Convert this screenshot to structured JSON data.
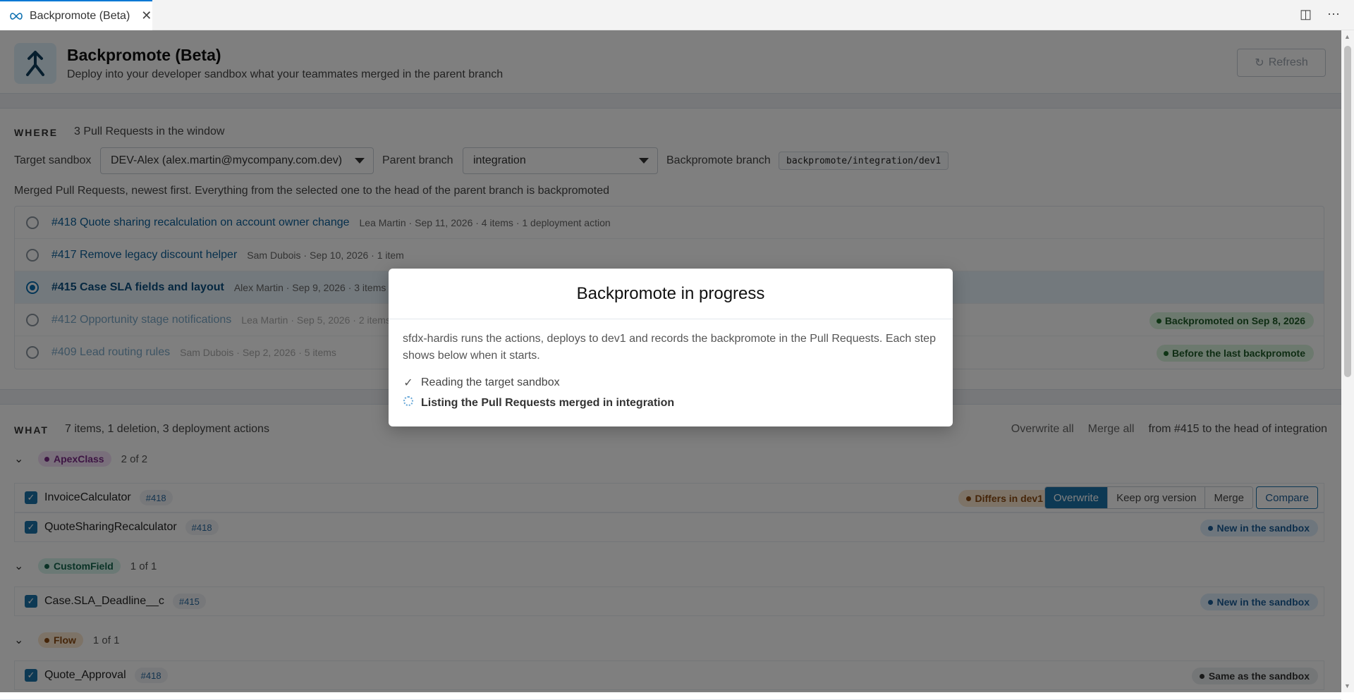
{
  "tab": {
    "title": "Backpromote (Beta)"
  },
  "header": {
    "title": "Backpromote (Beta)",
    "subtitle": "Deploy into your developer sandbox what your teammates merged in the parent branch",
    "refresh_label": "Refresh"
  },
  "where": {
    "label": "WHERE",
    "meta": "3 Pull Requests in the window",
    "target_label": "Target sandbox",
    "target_value": "DEV-Alex (alex.martin@mycompany.com.dev)",
    "parent_label": "Parent branch",
    "parent_value": "integration",
    "branch_label": "Backpromote branch",
    "branch_value": "backpromote/integration/dev1",
    "help": "Merged Pull Requests, newest first. Everything from the selected one to the head of the parent branch is backpromoted",
    "prs": [
      {
        "title": "#418 Quote sharing recalculation on account owner change",
        "meta": "Lea Martin · Sep 11, 2026 · 4 items · 1 deployment action",
        "badge": ""
      },
      {
        "title": "#417 Remove legacy discount helper",
        "meta": "Sam Dubois · Sep 10, 2026 · 1 item",
        "badge": ""
      },
      {
        "title": "#415 Case SLA fields and layout",
        "meta": "Alex Martin · Sep 9, 2026 · 3 items",
        "badge": ""
      },
      {
        "title": "#412 Opportunity stage notifications",
        "meta": "Lea Martin · Sep 5, 2026 · 2 items",
        "badge": "Backpromoted on Sep 8, 2026"
      },
      {
        "title": "#409 Lead routing rules",
        "meta": "Sam Dubois · Sep 2, 2026 · 5 items",
        "badge": "Before the last backpromote"
      }
    ]
  },
  "what": {
    "label": "WHAT",
    "meta": "7 items, 1 deletion, 3 deployment actions",
    "overwrite_all": "Overwrite all",
    "merge_all": "Merge all",
    "scope": "from #415 to the head of integration",
    "groups": [
      {
        "type": "ApexClass",
        "count": "2 of 2"
      },
      {
        "type": "CustomField",
        "count": "1 of 1"
      },
      {
        "type": "Flow",
        "count": "1 of 1"
      }
    ],
    "items": [
      {
        "name": "InvoiceCalculator",
        "pr": "#418",
        "status": "Differs in dev1"
      },
      {
        "name": "QuoteSharingRecalculator",
        "pr": "#418",
        "status": "New in the sandbox"
      },
      {
        "name": "Case.SLA_Deadline__c",
        "pr": "#415",
        "status": "New in the sandbox"
      },
      {
        "name": "Quote_Approval",
        "pr": "#418",
        "status": "Same as the sandbox"
      }
    ],
    "segment": [
      "Overwrite",
      "Keep org version",
      "Merge"
    ],
    "compare_label": "Compare"
  },
  "modal": {
    "title": "Backpromote in progress",
    "description": "sfdx-hardis runs the actions, deploys to dev1 and records the backpromote in the Pull Requests. Each step shows below when it starts.",
    "steps": [
      {
        "label": "Reading the target sandbox",
        "state": "done"
      },
      {
        "label": "Listing the Pull Requests merged in integration",
        "state": "active"
      }
    ]
  }
}
